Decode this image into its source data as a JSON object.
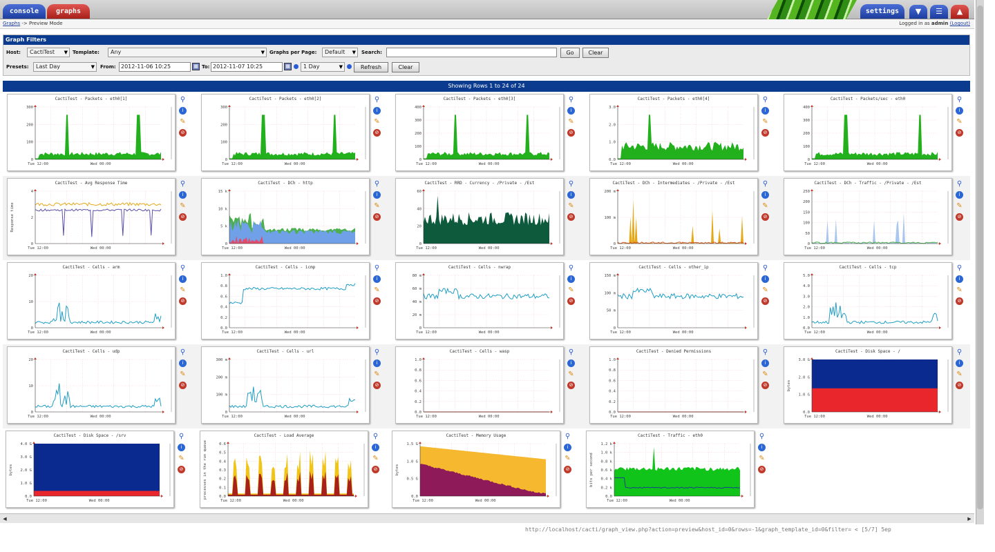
{
  "tabs": {
    "console": "console",
    "graphs": "graphs",
    "settings": "settings"
  },
  "icons": {
    "tree": "tree-icon",
    "list": "list-icon",
    "graph": "graph-icon"
  },
  "breadcrumb": {
    "link": "Graphs",
    "rest": "-> Preview Mode"
  },
  "login": {
    "prefix": "Logged in as",
    "user": "admin",
    "logout": "(Logout)"
  },
  "filters": {
    "title": "Graph Filters",
    "host_label": "Host:",
    "host_value": "CactiTest",
    "template_label": "Template:",
    "template_value": "Any",
    "per_page_label": "Graphs per Page:",
    "per_page_value": "Default",
    "search_label": "Search:",
    "search_value": "",
    "go_label": "Go",
    "clear_label": "Clear",
    "presets_label": "Presets:",
    "presets_value": "Last Day",
    "from_label": "From:",
    "from_value": "2012-11-06 10:25",
    "to_label": "To:",
    "to_value": "2012-11-07 10:25",
    "timespan_value": "1 Day",
    "refresh_label": "Refresh",
    "clear2_label": "Clear"
  },
  "showing": "Showing Rows 1 to 24 of 24",
  "graphs": [
    {
      "title": "CactiTest - Packets - eth0[1]",
      "ylabels": [
        "300",
        "200",
        "100",
        "0"
      ],
      "xlabels": [
        "Tue 12:00",
        "Wed 00:00"
      ],
      "kind": "spikes",
      "colors": [
        "#22b01c"
      ],
      "level": 0.12,
      "spikes": [
        0.25,
        0.82
      ]
    },
    {
      "title": "CactiTest - Packets - eth0[2]",
      "ylabels": [
        "300",
        "200",
        "100",
        "0"
      ],
      "xlabels": [
        "Tue 12:00",
        "Wed 00:00"
      ],
      "kind": "spikes",
      "colors": [
        "#22b01c"
      ],
      "level": 0.12,
      "spikes": [
        0.27,
        0.84
      ]
    },
    {
      "title": "CactiTest - Packets - eth0[3]",
      "ylabels": [
        "400",
        "300",
        "200",
        "100",
        "0"
      ],
      "xlabels": [
        "Tue 12:00",
        "Wed 00:00"
      ],
      "kind": "spikes",
      "colors": [
        "#22b01c"
      ],
      "level": 0.12,
      "spikes": [
        0.25,
        0.83
      ]
    },
    {
      "title": "CactiTest - Packets - eth0[4]",
      "ylabels": [
        "3.0",
        "2.0",
        "1.0",
        "0.0"
      ],
      "xlabels": [
        "Tue 12:00",
        "Wed 00:00"
      ],
      "kind": "spikes",
      "colors": [
        "#22b01c"
      ],
      "level": 0.28,
      "spikes": [
        0.25
      ]
    },
    {
      "title": "CactiTest - Packets/sec - eth0",
      "ylabels": [
        "400",
        "300",
        "200",
        "100",
        "0"
      ],
      "xlabels": [
        "Tue 12:00",
        "Wed 00:00"
      ],
      "kind": "spikes",
      "colors": [
        "#22b01c"
      ],
      "level": 0.12,
      "spikes": [
        0.27,
        0.86
      ]
    },
    {
      "title": "CactiTest - Avg Response Time",
      "ylabels": [
        "4",
        "2",
        "0"
      ],
      "xlabels": [
        "Tue 12:00",
        "Wed 00:00"
      ],
      "ylabel_axis": "Response time",
      "kind": "response",
      "colors": [
        "#e6a817",
        "#5b4fa8"
      ]
    },
    {
      "title": "CactiTest - DCh - http",
      "ylabels": [
        "15 k",
        "10 k",
        "5 k",
        "0"
      ],
      "xlabels": [
        "Tue 12:00",
        "Wed 00:00"
      ],
      "kind": "http",
      "colors": [
        "#6fa0e8",
        "#4caf50",
        "#e04c6a"
      ]
    },
    {
      "title": "CactiTest - RRD - Currency - /Private - /Est",
      "ylabels": [
        "60",
        "40",
        "20",
        "0"
      ],
      "xlabels": [
        "Tue 12:00",
        "Wed 00:00"
      ],
      "kind": "dense",
      "colors": [
        "#0d5a3c"
      ],
      "level": 0.5
    },
    {
      "title": "CactiTest - DCh - Intermediates - /Private - /Est",
      "ylabels": [
        "200 m",
        "100 m",
        "0"
      ],
      "xlabels": [
        "Tue 12:00",
        "Wed 00:00"
      ],
      "kind": "sparse",
      "colors": [
        "#e6a817",
        "#d05a2a"
      ]
    },
    {
      "title": "CactiTest - DCh - Traffic - /Private - /Est",
      "ylabels": [
        "250",
        "200",
        "150",
        "100",
        "50",
        "0"
      ],
      "xlabels": [
        "Tue 12:00",
        "Wed 00:00"
      ],
      "kind": "sparse",
      "colors": [
        "#a9c6ee",
        "#4caf50"
      ]
    },
    {
      "title": "CactiTest - Cells - arm",
      "ylabels": [
        "20",
        "10",
        "0"
      ],
      "xlabels": [
        "Tue 12:00",
        "Wed 00:00"
      ],
      "kind": "line-spiky",
      "colors": [
        "#1e9ec4"
      ]
    },
    {
      "title": "CactiTest - Cells - icmp",
      "ylabels": [
        "1.0",
        "0.8",
        "0.6",
        "0.4",
        "0.2",
        "0.0"
      ],
      "xlabels": [
        "Tue 12:00",
        "Wed 00:00"
      ],
      "kind": "line-step",
      "colors": [
        "#1e9ec4"
      ]
    },
    {
      "title": "CactiTest - Cells - nwrap",
      "ylabels": [
        "80 m",
        "60 m",
        "40 m",
        "20 m",
        "0"
      ],
      "xlabels": [
        "Tue 12:00",
        "Wed 00:00"
      ],
      "kind": "line-mid",
      "colors": [
        "#1e9ec4"
      ]
    },
    {
      "title": "CactiTest - Cells - other_ip",
      "ylabels": [
        "150 m",
        "100 m",
        "50 m",
        "0"
      ],
      "xlabels": [
        "Tue 12:00",
        "Wed 00:00"
      ],
      "kind": "line-mid",
      "colors": [
        "#1e9ec4"
      ]
    },
    {
      "title": "CactiTest - Cells - tcp",
      "ylabels": [
        "5.0",
        "4.0",
        "3.0",
        "2.0",
        "1.0",
        "0.0"
      ],
      "xlabels": [
        "Tue 12:00",
        "Wed 00:00"
      ],
      "kind": "line-spiky",
      "colors": [
        "#1e9ec4"
      ]
    },
    {
      "title": "CactiTest - Cells - udp",
      "ylabels": [
        "20",
        "10",
        "0"
      ],
      "xlabels": [
        "Tue 12:00",
        "Wed 00:00"
      ],
      "kind": "line-spiky",
      "colors": [
        "#1e9ec4"
      ]
    },
    {
      "title": "CactiTest - Cells - url",
      "ylabels": [
        "300 m",
        "200 m",
        "100 m",
        "0"
      ],
      "xlabels": [
        "Tue 12:00",
        "Wed 00:00"
      ],
      "kind": "line-spiky",
      "colors": [
        "#1e9ec4"
      ]
    },
    {
      "title": "CactiTest - Cells - wasp",
      "ylabels": [
        "1.0",
        "0.8",
        "0.6",
        "0.4",
        "0.2",
        "0.0"
      ],
      "xlabels": [
        "Tue 12:00",
        "Wed 00:00"
      ],
      "kind": "empty",
      "colors": [
        "#c0392b"
      ]
    },
    {
      "title": "CactiTest - Denied Permissions",
      "ylabels": [
        "1.0",
        "0.8",
        "0.6",
        "0.4",
        "0.2",
        "0.0"
      ],
      "xlabels": [
        "Tue 12:00",
        "Wed 00:00"
      ],
      "kind": "empty",
      "colors": [
        "#c0392b"
      ]
    },
    {
      "title": "CactiTest - Disk Space - /",
      "ylabels": [
        "3.0 G",
        "2.0 G",
        "1.0 G",
        "0.0"
      ],
      "xlabels": [
        "Tue 12:00",
        "Wed 00:00"
      ],
      "ylabel_axis": "bytes",
      "kind": "disk",
      "colors": [
        "#0a2a8f",
        "#e8262b"
      ],
      "level": 0.45
    },
    {
      "title": "CactiTest - Disk Space - /srv",
      "ylabels": [
        "4.0 G",
        "3.0 G",
        "2.0 G",
        "1.0 G",
        "0.0"
      ],
      "xlabels": [
        "Tue 12:00",
        "Wed 00:00"
      ],
      "ylabel_axis": "bytes",
      "kind": "disk",
      "colors": [
        "#0a2a8f",
        "#e8262b"
      ],
      "level": 0.1
    },
    {
      "title": "CactiTest - Load Average",
      "ylabels": [
        "0.6",
        "0.5",
        "0.4",
        "0.3",
        "0.2",
        "0.1",
        "0.0"
      ],
      "xlabels": [
        "Tue 12:00",
        "Wed 00:00"
      ],
      "ylabel_axis": "processes in the run queue",
      "kind": "load",
      "colors": [
        "#f0c419",
        "#a8201a"
      ]
    },
    {
      "title": "CactiTest - Memory Usage",
      "ylabels": [
        "1.5 G",
        "1.0 G",
        "0.5 G",
        "0.0"
      ],
      "xlabels": [
        "Tue 12:00",
        "Wed 00:00"
      ],
      "ylabel_axis": "bytes",
      "kind": "memory",
      "colors": [
        "#f5b82e",
        "#8e1a5a"
      ]
    },
    {
      "title": "CactiTest - Traffic - eth0",
      "ylabels": [
        "1.2 k",
        "1.0 k",
        "0.8 k",
        "0.6 k",
        "0.4 k",
        "0.2 k",
        "0.0"
      ],
      "xlabels": [
        "Tue 12:00",
        "Wed 00:00"
      ],
      "ylabel_axis": "bits per second",
      "kind": "traffic",
      "colors": [
        "#10c41a",
        "#1a3f8f"
      ]
    }
  ],
  "status_url": "http://localhost/cacti/graph_view.php?action=preview&host_id=0&rows=-1&graph_template_id=0&filter= < [5/7] 5ep"
}
